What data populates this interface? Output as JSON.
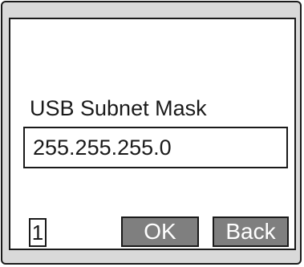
{
  "screen": {
    "title": "USB Subnet Mask",
    "field_value": "255.255.255.0",
    "index": "1"
  },
  "buttons": {
    "ok_label": "OK",
    "back_label": "Back"
  },
  "colors": {
    "bezel": "#d9d9d9",
    "screen_bg": "#ffffff",
    "button_bg": "#7f7f7f",
    "border": "#1a1a1a"
  }
}
